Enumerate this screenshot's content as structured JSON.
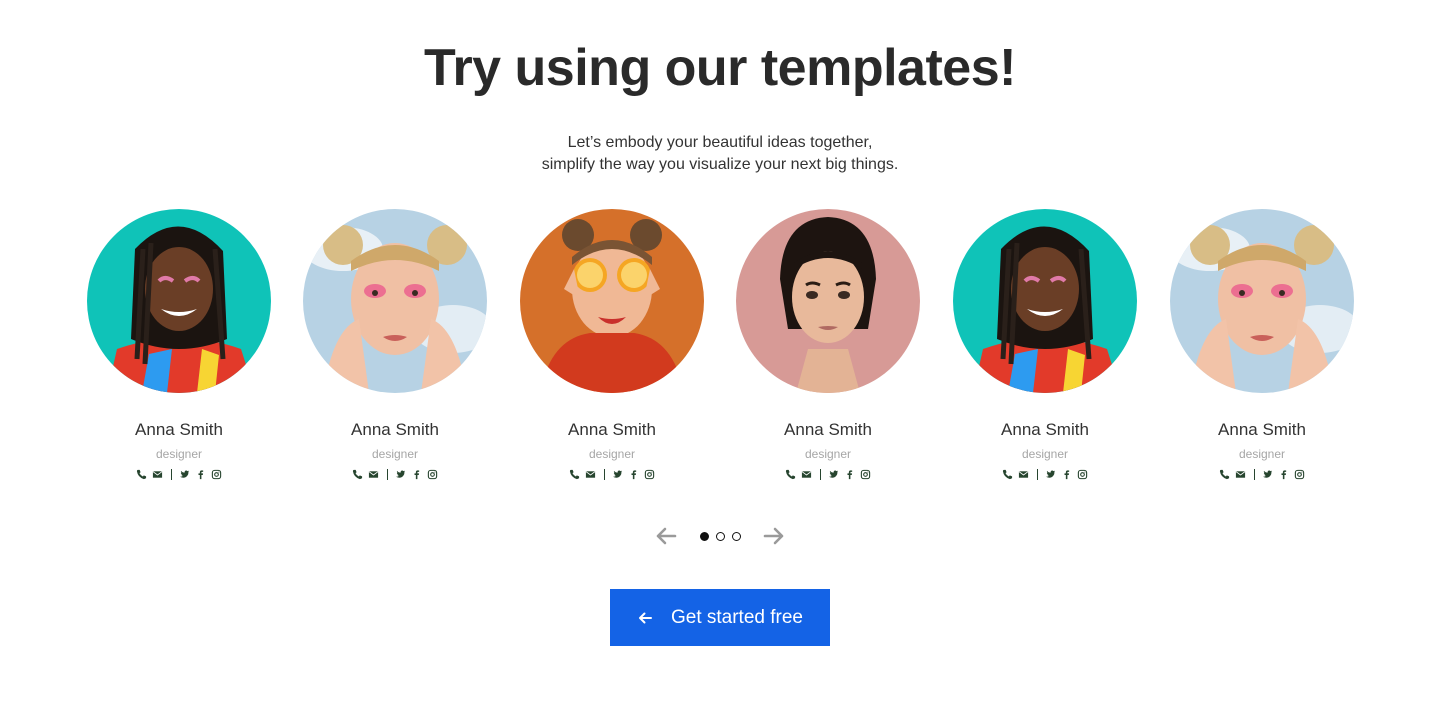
{
  "hero": {
    "title": "Try using our templates!",
    "subtitle_line1": "Let’s embody your beautiful ideas together,",
    "subtitle_line2": "simplify the way you visualize your next big things."
  },
  "team": {
    "cards": [
      {
        "name": "Anna Smith",
        "role": "designer",
        "photo": "woman-teal-background"
      },
      {
        "name": "Anna Smith",
        "role": "designer",
        "photo": "woman-hands-face-sky"
      },
      {
        "name": "Anna Smith",
        "role": "designer",
        "photo": "woman-orange-slices"
      },
      {
        "name": "Anna Smith",
        "role": "designer",
        "photo": "woman-pink-background"
      },
      {
        "name": "Anna Smith",
        "role": "designer",
        "photo": "woman-teal-background"
      },
      {
        "name": "Anna Smith",
        "role": "designer",
        "photo": "woman-hands-face-sky"
      }
    ],
    "social_icons": [
      "phone-icon",
      "mail-icon",
      "twitter-icon",
      "facebook-icon",
      "instagram-icon"
    ]
  },
  "carousel": {
    "pages": 3,
    "active_page": 1,
    "prev_icon": "arrow-left-icon",
    "next_icon": "arrow-right-icon"
  },
  "cta": {
    "label": "Get started free",
    "icon": "arrow-left-icon"
  },
  "colors": {
    "accent": "#1463e6",
    "title": "#2a2a2a",
    "role": "#a6a6a6",
    "social": "#27452f"
  }
}
